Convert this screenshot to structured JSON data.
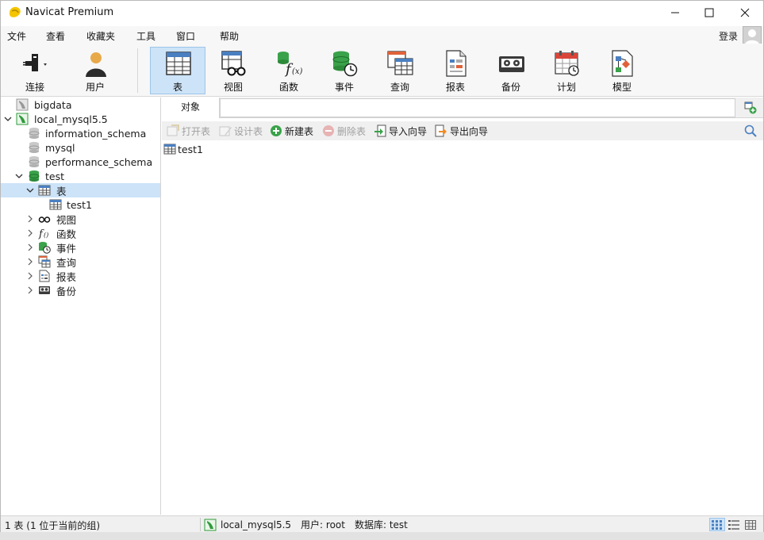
{
  "window": {
    "title": "Navicat Premium",
    "icons": {
      "logo": "navicat-logo-icon",
      "minimize": "minimize-icon",
      "maximize": "maximize-icon",
      "close": "close-icon"
    }
  },
  "menu": {
    "items": [
      "文件",
      "查看",
      "收藏夹",
      "工具",
      "窗口",
      "帮助"
    ],
    "login": "登录"
  },
  "toolbar": {
    "items": [
      {
        "label": "连接",
        "icon": "plug-icon"
      },
      {
        "label": "用户",
        "icon": "user-icon"
      },
      {
        "label": "表",
        "icon": "table-icon",
        "active": true
      },
      {
        "label": "视图",
        "icon": "view-glasses-icon"
      },
      {
        "label": "函数",
        "icon": "function-icon"
      },
      {
        "label": "事件",
        "icon": "event-clock-icon"
      },
      {
        "label": "查询",
        "icon": "query-icon"
      },
      {
        "label": "报表",
        "icon": "report-icon"
      },
      {
        "label": "备份",
        "icon": "backup-icon"
      },
      {
        "label": "计划",
        "icon": "schedule-calendar-icon"
      },
      {
        "label": "模型",
        "icon": "model-icon"
      }
    ]
  },
  "sidebar": {
    "items": [
      {
        "label": "bigdata",
        "level": 0,
        "icon": "connection-gray-icon",
        "arrow": ""
      },
      {
        "label": "local_mysql5.5",
        "level": 0,
        "icon": "connection-green-icon",
        "arrow": "down"
      },
      {
        "label": "information_schema",
        "level": 1,
        "icon": "database-gray-icon",
        "arrow": ""
      },
      {
        "label": "mysql",
        "level": 1,
        "icon": "database-gray-icon",
        "arrow": ""
      },
      {
        "label": "performance_schema",
        "level": 1,
        "icon": "database-gray-icon",
        "arrow": ""
      },
      {
        "label": "test",
        "level": 1,
        "icon": "database-green-icon",
        "arrow": "down"
      },
      {
        "label": "表",
        "level": 2,
        "icon": "table-icon",
        "arrow": "down",
        "selected": true
      },
      {
        "label": "test1",
        "level": 3,
        "icon": "table-icon",
        "arrow": ""
      },
      {
        "label": "视图",
        "level": 2,
        "icon": "view-glasses-icon",
        "arrow": "right"
      },
      {
        "label": "函数",
        "level": 2,
        "icon": "function-icon",
        "arrow": "right"
      },
      {
        "label": "事件",
        "level": 2,
        "icon": "event-clock-icon",
        "arrow": "right"
      },
      {
        "label": "查询",
        "level": 2,
        "icon": "query-icon",
        "arrow": "right"
      },
      {
        "label": "报表",
        "level": 2,
        "icon": "report-icon",
        "arrow": "right"
      },
      {
        "label": "备份",
        "level": 2,
        "icon": "backup-icon",
        "arrow": "right"
      }
    ]
  },
  "main": {
    "tab": "对象",
    "actions": [
      {
        "label": "打开表",
        "icon": "open-table-icon",
        "enabled": false
      },
      {
        "label": "设计表",
        "icon": "design-table-icon",
        "enabled": false
      },
      {
        "label": "新建表",
        "icon": "new-table-icon",
        "enabled": true
      },
      {
        "label": "删除表",
        "icon": "delete-table-icon",
        "enabled": false
      },
      {
        "label": "导入向导",
        "icon": "import-wizard-icon",
        "enabled": true
      },
      {
        "label": "导出向导",
        "icon": "export-wizard-icon",
        "enabled": true
      }
    ],
    "objects": [
      "test1"
    ]
  },
  "status": {
    "summary": "1 表 (1 位于当前的组)",
    "connection": "local_mysql5.5",
    "user": "用户: root",
    "database": "数据库: test"
  },
  "colors": {
    "accent": "#cde3f7",
    "accent_border": "#9cc5ea",
    "green": "#2e9b3a"
  }
}
